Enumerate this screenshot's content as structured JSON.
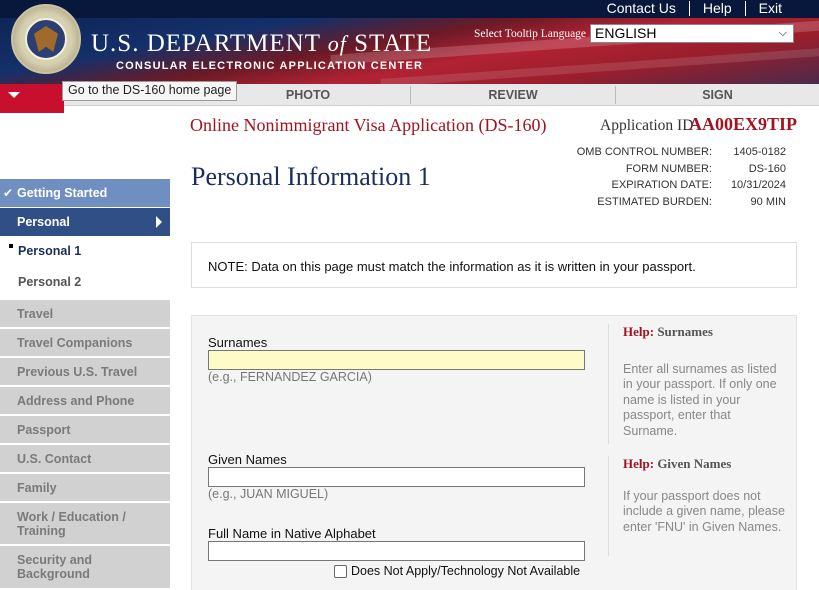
{
  "header": {
    "dept_title_prefix": "U.S. DEPARTMENT",
    "dept_title_of": "of",
    "dept_title_suffix": "STATE",
    "dept_subtitle": "CONSULAR ELECTRONIC APPLICATION CENTER",
    "top_links": [
      "Contact Us",
      "Help",
      "Exit"
    ],
    "tooltip_language_label": "Select Tooltip Language",
    "language_selected": "ENGLISH"
  },
  "nav": {
    "home_tooltip": "Go to the DS-160 home page",
    "tabs": [
      "PHOTO",
      "REVIEW",
      "SIGN"
    ]
  },
  "app": {
    "title": "Online Nonimmigrant Visa Application (DS-160)",
    "id_label": "Application ID",
    "id_value": "AA00EX9TIP",
    "omb": [
      {
        "k": "OMB CONTROL NUMBER:",
        "v": "1405-0182"
      },
      {
        "k": "FORM NUMBER:",
        "v": "DS-160"
      },
      {
        "k": "EXPIRATION DATE:",
        "v": "10/31/2024"
      },
      {
        "k": "ESTIMATED BURDEN:",
        "v": "90 MIN"
      }
    ],
    "page_title": "Personal Information 1"
  },
  "sidebar": {
    "getting_started": "Getting Started",
    "personal": "Personal",
    "personal1": "Personal 1",
    "personal2": "Personal 2",
    "sections": [
      "Travel",
      "Travel Companions",
      "Previous U.S. Travel",
      "Address and Phone",
      "Passport",
      "U.S. Contact",
      "Family",
      "Work / Education / Training",
      "Security and Background"
    ]
  },
  "note": "NOTE: Data on this page must match the information as it is written in your passport.",
  "form": {
    "surnames_label": "Surnames",
    "surnames_value": "",
    "surnames_example": "(e.g., FERNANDEZ GARCIA)",
    "given_label": "Given Names",
    "given_value": "",
    "given_example": "(e.g., JUAN MIGUEL)",
    "native_label": "Full Name in Native Alphabet",
    "native_value": "",
    "does_not_apply": "Does Not Apply/Technology Not Available"
  },
  "help": {
    "prefix": "Help:",
    "surnames_title": "Surnames",
    "surnames_text": "Enter all surnames as listed in your passport. If only one name is listed in your passport, enter that Surname.",
    "given_title": "Given Names",
    "given_text": "If your passport does not include a given name, please enter 'FNU' in Given Names."
  }
}
